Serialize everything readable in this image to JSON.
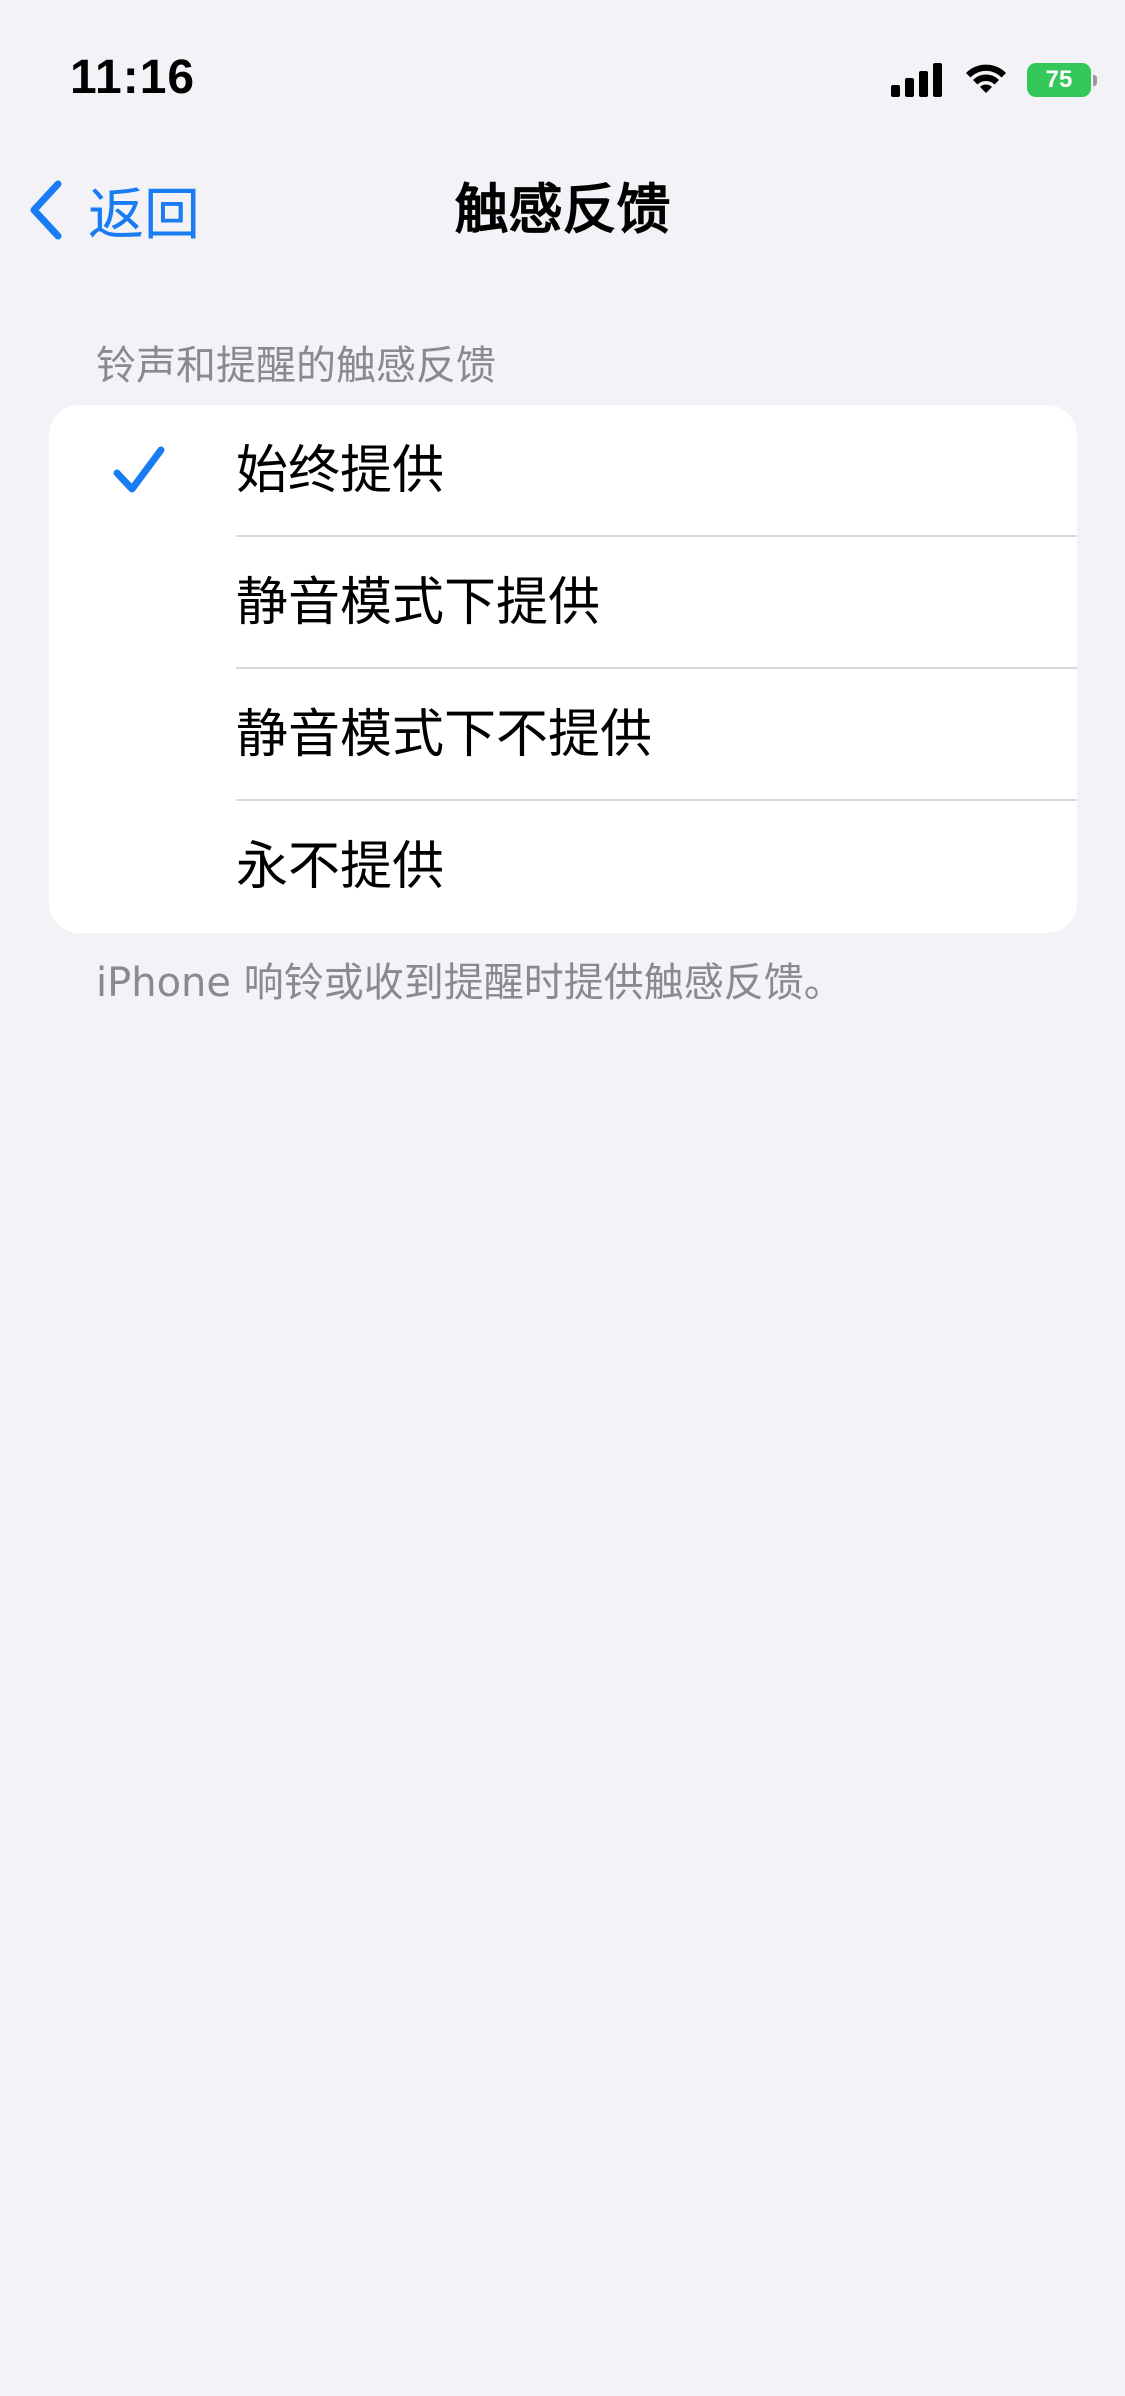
{
  "status_bar": {
    "time": "11:16",
    "battery": "75",
    "icons": [
      "signal-icon",
      "wifi-icon",
      "battery-icon"
    ]
  },
  "nav": {
    "back_label": "返回",
    "title": "触感反馈"
  },
  "section": {
    "header": "铃声和提醒的触感反馈",
    "options": [
      {
        "label": "始终提供",
        "selected": true
      },
      {
        "label": "静音模式下提供",
        "selected": false
      },
      {
        "label": "静音模式下不提供",
        "selected": false
      },
      {
        "label": "永不提供",
        "selected": false
      }
    ],
    "footer": "iPhone 响铃或收到提醒时提供触感反馈。"
  },
  "colors": {
    "accent": "#1a7cf2",
    "background": "#f2f2f7",
    "secondary_text": "#8a8a8e",
    "battery": "#34c759"
  }
}
